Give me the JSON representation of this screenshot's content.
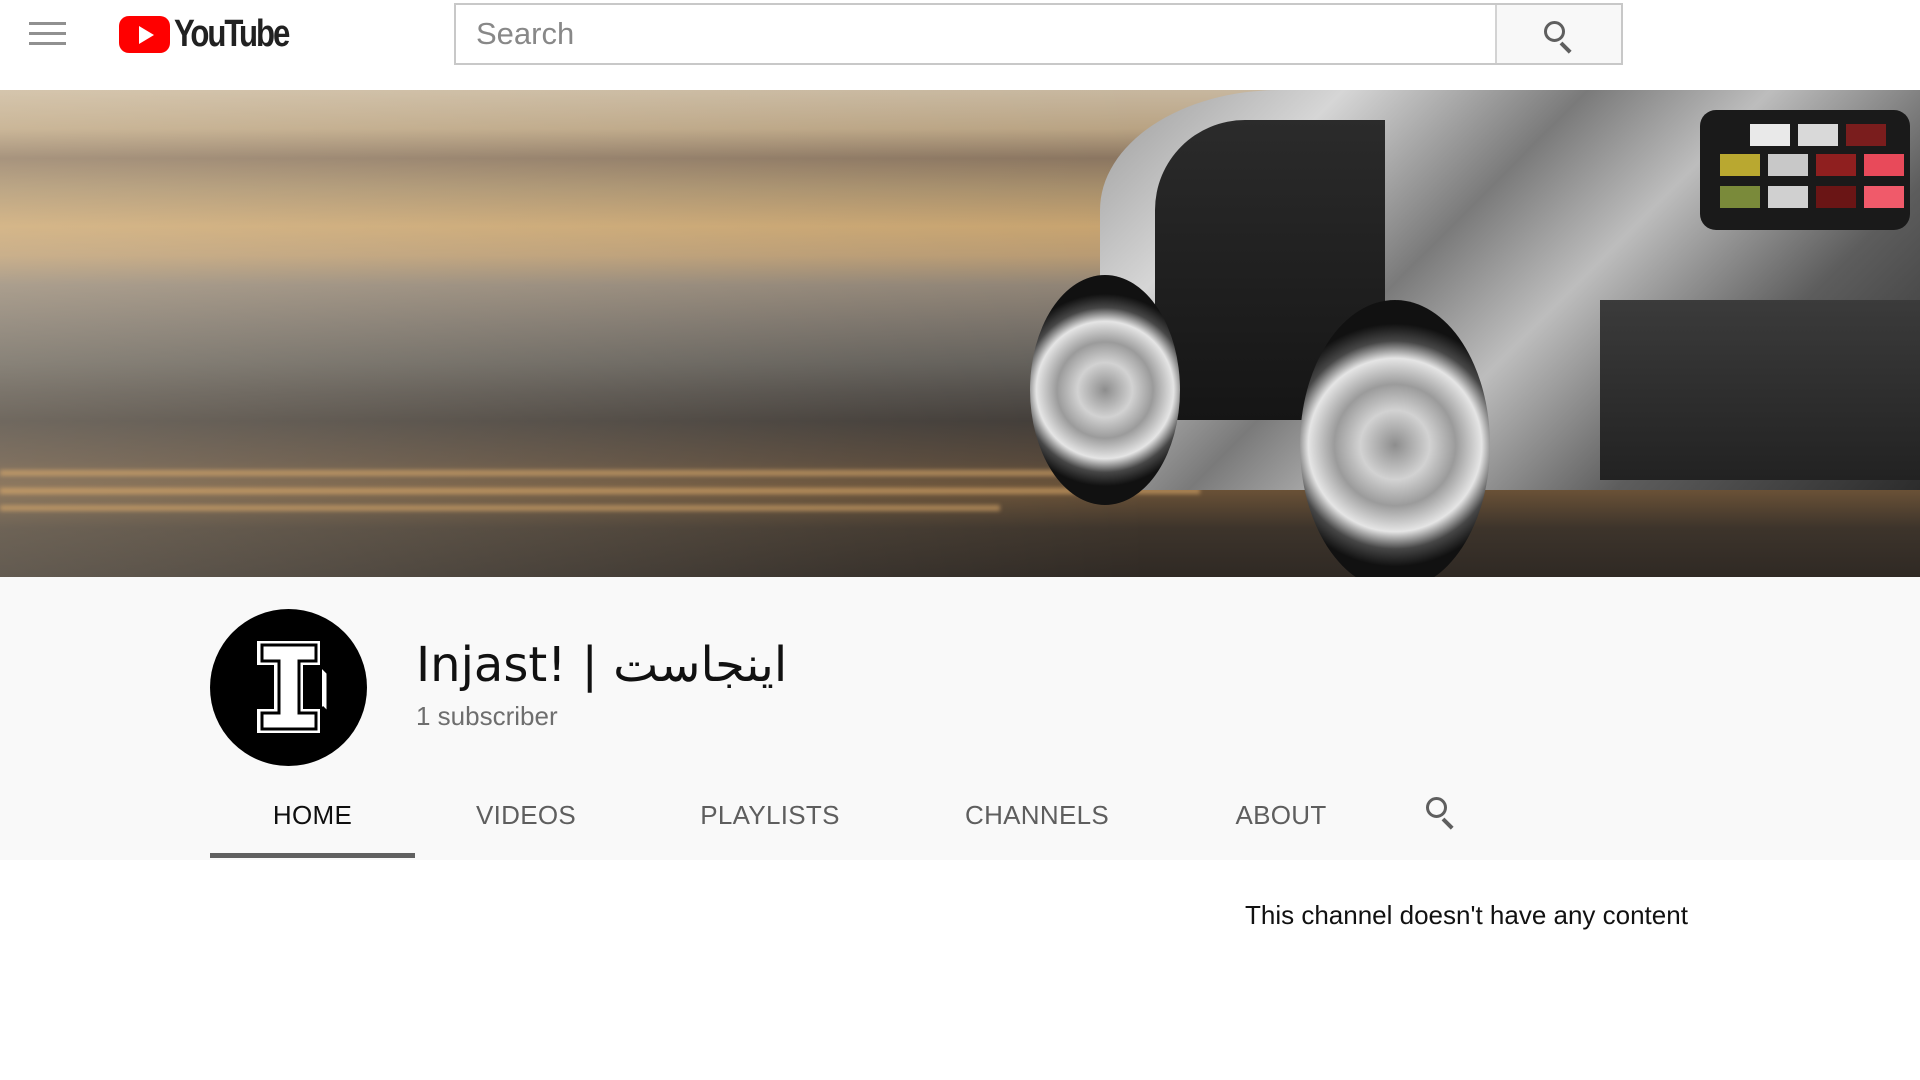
{
  "masthead": {
    "logo_text": "YouTube",
    "search_placeholder": "Search",
    "search_value": ""
  },
  "channel": {
    "name": "Injast! | اینجاست",
    "subscribers": "1 subscriber",
    "avatar_letter": "I"
  },
  "tabs": [
    {
      "label": "HOME",
      "active": true
    },
    {
      "label": "VIDEOS",
      "active": false
    },
    {
      "label": "PLAYLISTS",
      "active": false
    },
    {
      "label": "CHANNELS",
      "active": false
    },
    {
      "label": "ABOUT",
      "active": false
    }
  ],
  "content": {
    "empty_message": "This channel doesn't have any content"
  },
  "colors": {
    "brand_red": "#ff0000",
    "header_bg": "#f9f9f9",
    "active_tab_underline": "#606060"
  },
  "icons": [
    "menu-icon",
    "youtube-logo-icon",
    "search-icon",
    "channel-search-icon"
  ]
}
